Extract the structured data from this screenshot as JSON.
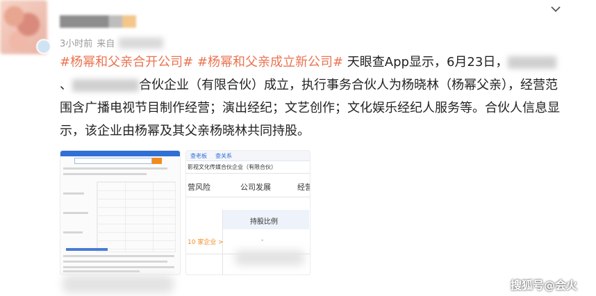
{
  "post": {
    "time": "3小时前",
    "source_prefix": "来自",
    "tag_1": "#杨幂和父亲合开公司#",
    "tag_2": "#杨幂和父亲成立新公司#",
    "body_part_1": " 天眼查App显示，6月23日，",
    "body_part_2": "、",
    "body_part_3": "合伙企业（有限合伙）成立，执行事务合伙人为杨晓林（杨幂父亲），经营范围含广播电视节目制作经营；演出经纪；文艺创作；文化娱乐经纪人服务等。合伙人信息显示，该企业由杨幂及其父亲杨晓林共同持股。"
  },
  "image_2": {
    "tab_1": "查老板",
    "tab_2": "查关系",
    "company": "影视文化传媒合伙企业（有限合伙）",
    "nav_1": "营风险",
    "nav_2": "公司发展",
    "nav_3": "经营",
    "column": "持股比例",
    "row_link": "10 家企业 >",
    "row_value": "-"
  },
  "watermark": "搜狐号@会火",
  "icons": {
    "more": "chevron-down-icon"
  },
  "colors": {
    "tag": "#eb7350",
    "meta": "#9a9a9a"
  }
}
